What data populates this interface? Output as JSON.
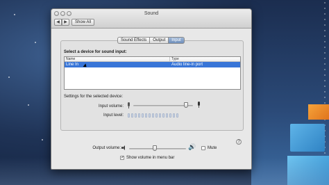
{
  "window": {
    "title": "Sound",
    "show_all_label": "Show All",
    "nav_back": "◀",
    "nav_forward": "▶"
  },
  "tabs": [
    {
      "label": "Sound Effects",
      "active": false
    },
    {
      "label": "Output",
      "active": false
    },
    {
      "label": "Input",
      "active": true
    }
  ],
  "input": {
    "select_label": "Select a device for sound input:",
    "columns": {
      "name": "Name",
      "type": "Type"
    },
    "devices": [
      {
        "name": "Line In",
        "type": "Audio line-in port",
        "selected": true
      }
    ],
    "settings_label": "Settings for the selected device:",
    "input_volume_label": "Input volume:",
    "input_volume_value": 0.88,
    "input_level_label": "Input level:",
    "input_level_segments": 15,
    "input_level_lit": 0,
    "help_label": "?"
  },
  "output": {
    "volume_label": "Output volume:",
    "volume_value": 0.45,
    "mute_label": "Mute",
    "mute_checked": false,
    "show_volume_label": "Show volume in menu bar",
    "show_volume_checked": true,
    "check_mark": "✓",
    "speaker_loud_glyph": "🔊"
  },
  "colors": {
    "selection": "#3875d7",
    "active_tab": "#7f9fc9"
  }
}
